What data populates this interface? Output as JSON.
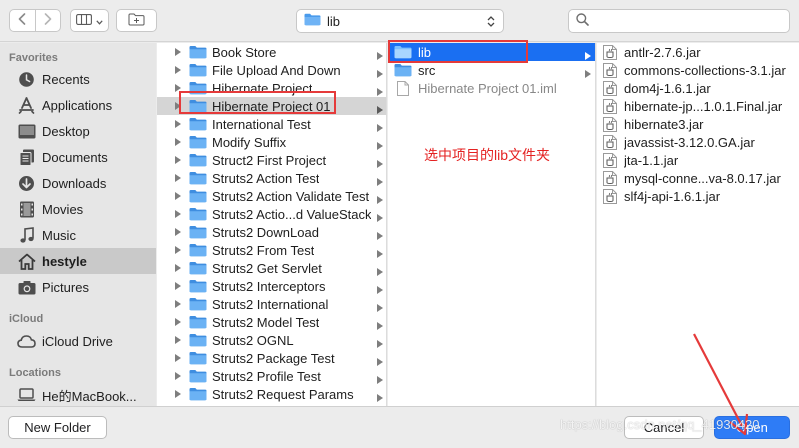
{
  "toolbar": {
    "path_label": "lib"
  },
  "sidebar": {
    "favorites_header": "Favorites",
    "favorites": [
      {
        "label": "Recents",
        "icon": "clock-icon"
      },
      {
        "label": "Applications",
        "icon": "applications-icon"
      },
      {
        "label": "Desktop",
        "icon": "desktop-icon"
      },
      {
        "label": "Documents",
        "icon": "document-icon"
      },
      {
        "label": "Downloads",
        "icon": "download-icon"
      },
      {
        "label": "Movies",
        "icon": "film-icon"
      },
      {
        "label": "Music",
        "icon": "music-note-icon"
      },
      {
        "label": "hestyle",
        "icon": "home-icon",
        "selected": true
      },
      {
        "label": "Pictures",
        "icon": "camera-icon"
      }
    ],
    "icloud_header": "iCloud",
    "icloud": [
      {
        "label": "iCloud Drive",
        "icon": "cloud-icon"
      }
    ],
    "locations_header": "Locations",
    "locations": [
      {
        "label": "He的MacBook...",
        "icon": "laptop-icon"
      }
    ]
  },
  "column1": {
    "items": [
      {
        "label": "Book Store"
      },
      {
        "label": "File Upload And Down"
      },
      {
        "label": "Hibernate Project"
      },
      {
        "label": "Hibernate Project 01",
        "selected": true
      },
      {
        "label": "International Test"
      },
      {
        "label": "Modify Suffix"
      },
      {
        "label": "Struct2 First Project"
      },
      {
        "label": "Struts2 Action Test"
      },
      {
        "label": "Struts2 Action Validate Test"
      },
      {
        "label": "Struts2 Actio...d ValueStack"
      },
      {
        "label": "Struts2 DownLoad"
      },
      {
        "label": "Struts2 From Test"
      },
      {
        "label": "Struts2 Get Servlet"
      },
      {
        "label": "Struts2 Interceptors"
      },
      {
        "label": "Struts2 International"
      },
      {
        "label": "Struts2 Model Test"
      },
      {
        "label": "Struts2 OGNL"
      },
      {
        "label": "Struts2 Package Test"
      },
      {
        "label": "Struts2 Profile Test"
      },
      {
        "label": "Struts2 Request Params"
      }
    ]
  },
  "column2": {
    "items": [
      {
        "label": "lib",
        "type": "folder",
        "selected": true
      },
      {
        "label": "src",
        "type": "folder"
      },
      {
        "label": "Hibernate Project 01.iml",
        "type": "file"
      }
    ]
  },
  "column3": {
    "items": [
      {
        "label": "antlr-2.7.6.jar"
      },
      {
        "label": "commons-collections-3.1.jar"
      },
      {
        "label": "dom4j-1.6.1.jar"
      },
      {
        "label": "hibernate-jp...1.0.1.Final.jar"
      },
      {
        "label": "hibernate3.jar"
      },
      {
        "label": "javassist-3.12.0.GA.jar"
      },
      {
        "label": "jta-1.1.jar"
      },
      {
        "label": "mysql-conne...va-8.0.17.jar"
      },
      {
        "label": "slf4j-api-1.6.1.jar"
      }
    ]
  },
  "annotation": {
    "text": "选中项目的lib文件夹"
  },
  "footer": {
    "new_folder_label": "New Folder",
    "cancel_label": "Cancel",
    "open_label": "Open"
  },
  "watermark": "https://blog.csdn.net/qq_41930420",
  "colors": {
    "accent": "#1a6ff2",
    "annotation": "#e53a3a",
    "folder": "#3f8ee0"
  }
}
